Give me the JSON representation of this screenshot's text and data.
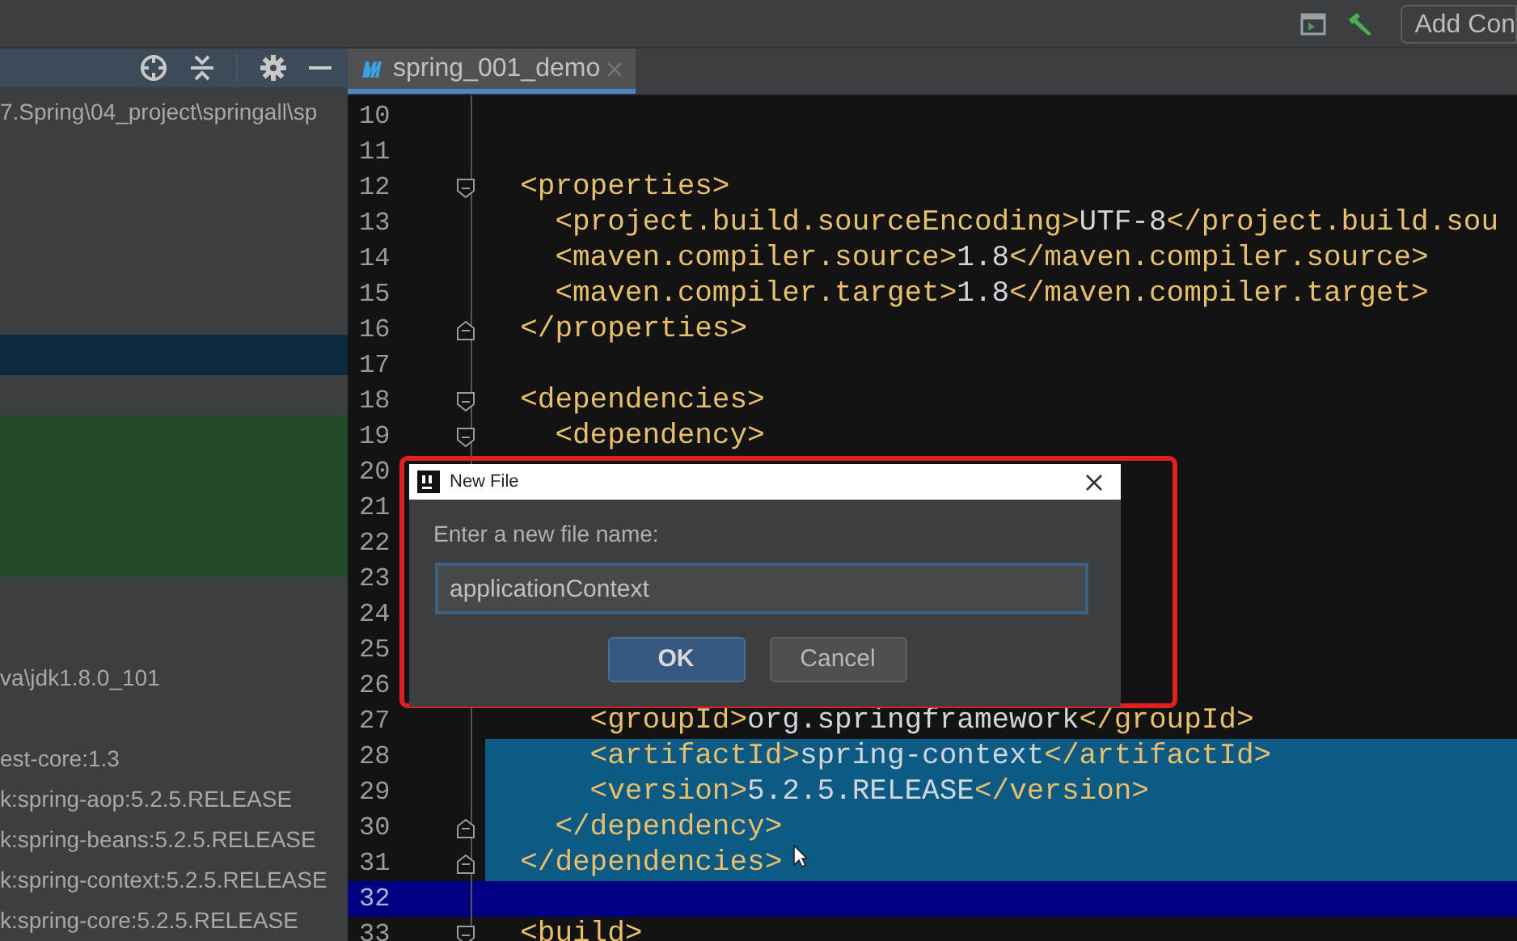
{
  "toolbar": {
    "run_config_button": "Add Con"
  },
  "project_panel": {
    "rows": [
      {
        "kind": "entry",
        "text": "7.Spring\\04_project\\springall\\sp",
        "selected": false,
        "highlighted": false
      },
      {
        "kind": "blank",
        "selected": false,
        "highlighted": false
      },
      {
        "kind": "blank",
        "selected": false,
        "highlighted": false
      },
      {
        "kind": "blank",
        "selected": false,
        "highlighted": false
      },
      {
        "kind": "blank",
        "selected": false,
        "highlighted": false
      },
      {
        "kind": "blank",
        "selected": false,
        "highlighted": false
      },
      {
        "kind": "blank",
        "selected": true,
        "highlighted": false
      },
      {
        "kind": "blank",
        "selected": false,
        "highlighted": false
      },
      {
        "kind": "blank",
        "selected": false,
        "highlighted": true
      },
      {
        "kind": "blank",
        "selected": false,
        "highlighted": true
      },
      {
        "kind": "blank",
        "selected": false,
        "highlighted": true
      },
      {
        "kind": "blank",
        "selected": false,
        "highlighted": true
      },
      {
        "kind": "blank",
        "selected": false,
        "highlighted": false
      },
      {
        "kind": "blank",
        "selected": false,
        "highlighted": false
      },
      {
        "kind": "entry",
        "text": "va\\jdk1.8.0_101",
        "selected": false,
        "highlighted": false
      },
      {
        "kind": "blank",
        "selected": false,
        "highlighted": false
      },
      {
        "kind": "entry",
        "text": "est-core:1.3",
        "selected": false,
        "highlighted": false
      },
      {
        "kind": "entry",
        "text": "k:spring-aop:5.2.5.RELEASE",
        "selected": false,
        "highlighted": false
      },
      {
        "kind": "entry",
        "text": "k:spring-beans:5.2.5.RELEASE",
        "selected": false,
        "highlighted": false
      },
      {
        "kind": "entry",
        "text": "k:spring-context:5.2.5.RELEASE",
        "selected": false,
        "highlighted": false
      },
      {
        "kind": "entry",
        "text": "k:spring-core:5.2.5.RELEASE",
        "selected": false,
        "highlighted": false
      }
    ]
  },
  "editor": {
    "tabs": [
      {
        "label": "spring_001_demo",
        "selected": true
      }
    ],
    "lines": [
      {
        "number": "10",
        "kind": "plain",
        "selected": false,
        "current": false
      },
      {
        "number": "11",
        "kind": "plain",
        "selected": false,
        "current": false
      },
      {
        "number": "12",
        "kind": "fold_start",
        "selected": false,
        "current": false,
        "segments": [
          {
            "kind": "tag",
            "text": "  <properties>"
          }
        ]
      },
      {
        "number": "13",
        "kind": "plain",
        "selected": false,
        "current": false,
        "segments": [
          {
            "kind": "tag",
            "text": "    <project.build.sourceEncoding>"
          },
          {
            "kind": "value",
            "text": "UTF-8"
          },
          {
            "kind": "tag",
            "text": "</project.build.sou"
          }
        ]
      },
      {
        "number": "14",
        "kind": "plain",
        "selected": false,
        "current": false,
        "segments": [
          {
            "kind": "tag",
            "text": "    <maven.compiler.source>"
          },
          {
            "kind": "value",
            "text": "1.8"
          },
          {
            "kind": "tag",
            "text": "</maven.compiler.source>"
          }
        ]
      },
      {
        "number": "15",
        "kind": "plain",
        "selected": false,
        "current": false,
        "segments": [
          {
            "kind": "tag",
            "text": "    <maven.compiler.target>"
          },
          {
            "kind": "value",
            "text": "1.8"
          },
          {
            "kind": "tag",
            "text": "</maven.compiler.target>"
          }
        ]
      },
      {
        "number": "16",
        "kind": "fold_end",
        "selected": false,
        "current": false,
        "segments": [
          {
            "kind": "tag",
            "text": "  </properties>"
          }
        ]
      },
      {
        "number": "17",
        "kind": "plain",
        "selected": false,
        "current": false
      },
      {
        "number": "18",
        "kind": "fold_start",
        "selected": false,
        "current": false,
        "segments": [
          {
            "kind": "tag",
            "text": "  <dependencies>"
          }
        ]
      },
      {
        "number": "19",
        "kind": "fold_start",
        "selected": false,
        "current": false,
        "segments": [
          {
            "kind": "tag",
            "text": "    <dependency>"
          }
        ]
      },
      {
        "number": "20",
        "kind": "plain",
        "selected": false,
        "current": false
      },
      {
        "number": "21",
        "kind": "plain",
        "selected": false,
        "current": false
      },
      {
        "number": "22",
        "kind": "plain",
        "selected": false,
        "current": false
      },
      {
        "number": "23",
        "kind": "plain",
        "selected": false,
        "current": false
      },
      {
        "number": "24",
        "kind": "plain",
        "selected": false,
        "current": false
      },
      {
        "number": "25",
        "kind": "plain",
        "selected": false,
        "current": false
      },
      {
        "number": "26",
        "kind": "plain",
        "selected": false,
        "current": false
      },
      {
        "number": "27",
        "kind": "plain",
        "selected": false,
        "current": false,
        "segments": [
          {
            "kind": "tag",
            "text": "      <groupId>"
          },
          {
            "kind": "value",
            "text": "org.springframework"
          },
          {
            "kind": "tag",
            "text": "</groupId>"
          }
        ]
      },
      {
        "number": "28",
        "kind": "plain",
        "selected": true,
        "current": false,
        "segments": [
          {
            "kind": "tag",
            "text": "      <artifactId>"
          },
          {
            "kind": "value",
            "text": "spring-context"
          },
          {
            "kind": "tag",
            "text": "</artifactId>"
          }
        ]
      },
      {
        "number": "29",
        "kind": "plain",
        "selected": true,
        "current": false,
        "segments": [
          {
            "kind": "tag",
            "text": "      <version>"
          },
          {
            "kind": "value",
            "text": "5.2.5.RELEASE"
          },
          {
            "kind": "tag",
            "text": "</version>"
          }
        ]
      },
      {
        "number": "30",
        "kind": "fold_end",
        "selected": true,
        "current": false,
        "segments": [
          {
            "kind": "tag",
            "text": "    </dependency>"
          }
        ]
      },
      {
        "number": "31",
        "kind": "fold_end",
        "selected": true,
        "current": false,
        "segments": [
          {
            "kind": "tag",
            "text": "  </dependencies>"
          }
        ]
      },
      {
        "number": "32",
        "kind": "plain",
        "selected": false,
        "current": true
      },
      {
        "number": "33",
        "kind": "fold_start",
        "selected": false,
        "current": false,
        "segments": [
          {
            "kind": "tag",
            "text": "  <build>"
          }
        ]
      }
    ]
  },
  "dialog": {
    "title": "New File",
    "prompt": "Enter a new file name:",
    "field_value": "applicationContext",
    "buttons": [
      {
        "label": "OK",
        "default": true
      },
      {
        "label": "Cancel",
        "default": false
      }
    ]
  }
}
